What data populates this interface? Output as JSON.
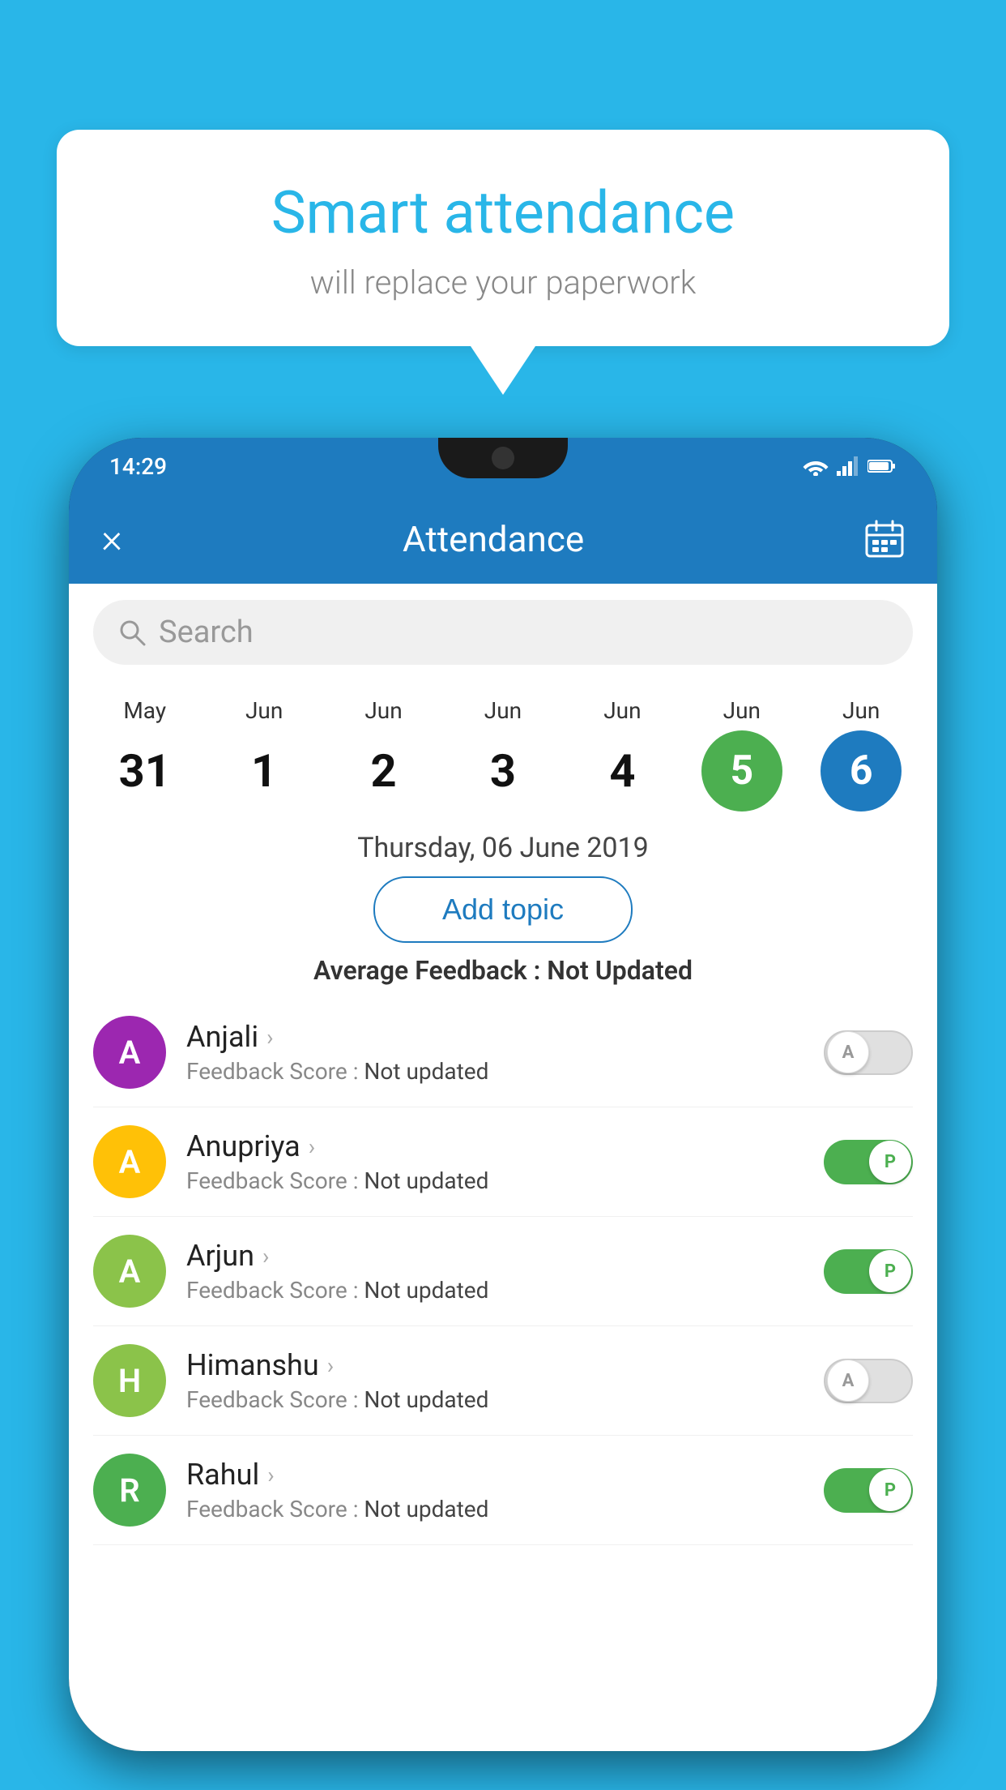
{
  "background_color": "#29b6e8",
  "speech_bubble": {
    "title": "Smart attendance",
    "subtitle": "will replace your paperwork"
  },
  "status_bar": {
    "time": "14:29",
    "wifi_icon": "wifi",
    "signal_icon": "signal",
    "battery_icon": "battery"
  },
  "header": {
    "title": "Attendance",
    "close_label": "×",
    "calendar_icon": "calendar"
  },
  "search": {
    "placeholder": "Search"
  },
  "calendar": {
    "days": [
      {
        "month": "May",
        "date": "31",
        "style": "normal"
      },
      {
        "month": "Jun",
        "date": "1",
        "style": "normal"
      },
      {
        "month": "Jun",
        "date": "2",
        "style": "normal"
      },
      {
        "month": "Jun",
        "date": "3",
        "style": "normal"
      },
      {
        "month": "Jun",
        "date": "4",
        "style": "normal"
      },
      {
        "month": "Jun",
        "date": "5",
        "style": "today"
      },
      {
        "month": "Jun",
        "date": "6",
        "style": "selected"
      }
    ],
    "selected_date": "Thursday, 06 June 2019"
  },
  "add_topic_button": "Add topic",
  "average_feedback_label": "Average Feedback :",
  "average_feedback_value": "Not Updated",
  "students": [
    {
      "name": "Anjali",
      "initial": "A",
      "avatar_color": "#9c27b0",
      "feedback_label": "Feedback Score :",
      "feedback_value": "Not updated",
      "toggle": "off",
      "toggle_letter": "A"
    },
    {
      "name": "Anupriya",
      "initial": "A",
      "avatar_color": "#ffc107",
      "feedback_label": "Feedback Score :",
      "feedback_value": "Not updated",
      "toggle": "on",
      "toggle_letter": "P"
    },
    {
      "name": "Arjun",
      "initial": "A",
      "avatar_color": "#8bc34a",
      "feedback_label": "Feedback Score :",
      "feedback_value": "Not updated",
      "toggle": "on",
      "toggle_letter": "P"
    },
    {
      "name": "Himanshu",
      "initial": "H",
      "avatar_color": "#8bc34a",
      "feedback_label": "Feedback Score :",
      "feedback_value": "Not updated",
      "toggle": "off",
      "toggle_letter": "A"
    },
    {
      "name": "Rahul",
      "initial": "R",
      "avatar_color": "#4caf50",
      "feedback_label": "Feedback Score :",
      "feedback_value": "Not updated",
      "toggle": "on",
      "toggle_letter": "P"
    }
  ]
}
